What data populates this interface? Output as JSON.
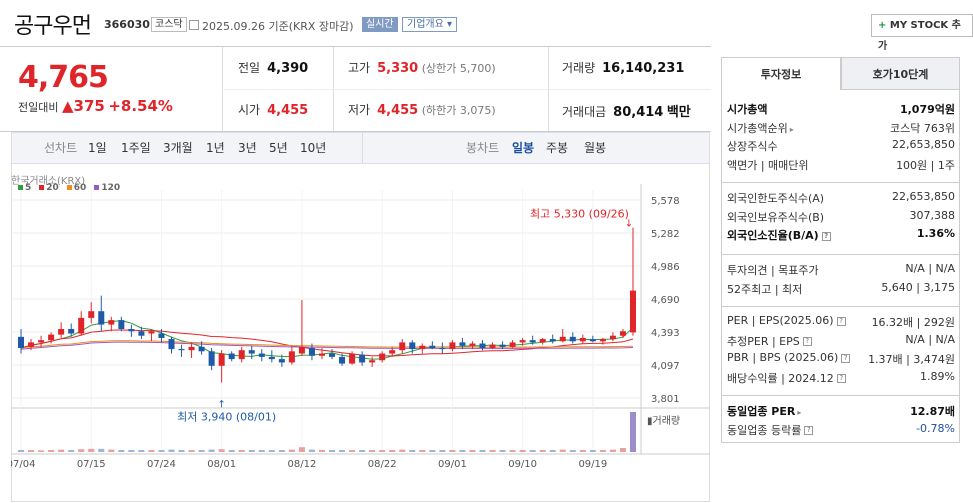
{
  "header": {
    "name": "공구우먼",
    "code": "366030",
    "market": "코스닥",
    "date_info": "2025.09.26 기준(KRX 장마감)",
    "realtime": "실시간",
    "overview": "기업개요",
    "mystock": "MY STOCK 추가",
    "mystock_plus": "+"
  },
  "quote": {
    "price": "4,765",
    "prev_label": "전일대비",
    "change": "▲375",
    "change_pct": "+8.54%",
    "prev_close_label": "전일",
    "prev_close": "4,390",
    "open_label": "시가",
    "open": "4,455",
    "high_label": "고가",
    "high": "5,330",
    "upper_limit": "(상한가 5,700)",
    "low_label": "저가",
    "low": "4,455",
    "lower_limit": "(하한가 3,075)",
    "volume_label": "거래량",
    "volume": "16,140,231",
    "value_label": "거래대금",
    "value": "80,414",
    "value_unit": "백만"
  },
  "periods": {
    "label": "선차트",
    "items": [
      "1일",
      "1주일",
      "3개월",
      "1년",
      "3년",
      "5년",
      "10년"
    ]
  },
  "candle_periods": {
    "label": "봉차트",
    "items": [
      "일봉",
      "주봉",
      "월봉"
    ],
    "active": "일봉"
  },
  "chart_data": {
    "type": "candlestick",
    "source": "한국거래소(KRX)",
    "legend": [
      {
        "name": "5",
        "color": "#2e9e3e"
      },
      {
        "name": "20",
        "color": "#e0252a"
      },
      {
        "name": "60",
        "color": "#f08c1e"
      },
      {
        "name": "120",
        "color": "#9b59c6"
      }
    ],
    "y_ticks": [
      5578,
      5282,
      4986,
      4690,
      4393,
      4097,
      3801
    ],
    "ylim": [
      3801,
      5578
    ],
    "x_ticks": [
      "07/04",
      "07/15",
      "07/24",
      "08/01",
      "08/12",
      "08/22",
      "09/01",
      "09/10",
      "09/19"
    ],
    "x_tick_index": [
      0,
      7,
      14,
      20,
      28,
      36,
      43,
      50,
      57
    ],
    "max_label": "최고 5,330 (09/26)",
    "min_label": "최저 3,940 (08/01)",
    "volume_label": "거래량",
    "candles": [
      [
        4350,
        4420,
        4200,
        4250
      ],
      [
        4260,
        4330,
        4230,
        4300
      ],
      [
        4300,
        4360,
        4260,
        4320
      ],
      [
        4320,
        4390,
        4290,
        4370
      ],
      [
        4370,
        4480,
        4340,
        4420
      ],
      [
        4420,
        4470,
        4350,
        4380
      ],
      [
        4380,
        4580,
        4360,
        4520
      ],
      [
        4520,
        4660,
        4470,
        4580
      ],
      [
        4580,
        4720,
        4400,
        4460
      ],
      [
        4460,
        4530,
        4400,
        4500
      ],
      [
        4500,
        4530,
        4400,
        4420
      ],
      [
        4420,
        4460,
        4350,
        4400
      ],
      [
        4400,
        4440,
        4330,
        4360
      ],
      [
        4380,
        4420,
        4310,
        4400
      ],
      [
        4380,
        4420,
        4300,
        4340
      ],
      [
        4330,
        4350,
        4200,
        4240
      ],
      [
        4240,
        4280,
        4170,
        4230
      ],
      [
        4230,
        4300,
        4160,
        4260
      ],
      [
        4260,
        4310,
        4190,
        4220
      ],
      [
        4220,
        4250,
        4050,
        4090
      ],
      [
        4090,
        4230,
        3940,
        4200
      ],
      [
        4200,
        4220,
        4130,
        4150
      ],
      [
        4150,
        4260,
        4120,
        4230
      ],
      [
        4230,
        4270,
        4150,
        4200
      ],
      [
        4200,
        4240,
        4130,
        4170
      ],
      [
        4170,
        4230,
        4120,
        4150
      ],
      [
        4150,
        4190,
        4080,
        4120
      ],
      [
        4120,
        4260,
        4100,
        4220
      ],
      [
        4200,
        4680,
        4180,
        4260
      ],
      [
        4250,
        4290,
        4140,
        4180
      ],
      [
        4180,
        4250,
        4150,
        4200
      ],
      [
        4200,
        4240,
        4150,
        4170
      ],
      [
        4170,
        4200,
        4090,
        4110
      ],
      [
        4110,
        4220,
        4100,
        4200
      ],
      [
        4190,
        4220,
        4090,
        4120
      ],
      [
        4120,
        4170,
        4080,
        4140
      ],
      [
        4140,
        4220,
        4120,
        4200
      ],
      [
        4200,
        4260,
        4170,
        4230
      ],
      [
        4230,
        4330,
        4200,
        4300
      ],
      [
        4300,
        4320,
        4200,
        4240
      ],
      [
        4240,
        4290,
        4200,
        4270
      ],
      [
        4270,
        4310,
        4240,
        4250
      ],
      [
        4250,
        4300,
        4200,
        4240
      ],
      [
        4240,
        4320,
        4220,
        4300
      ],
      [
        4300,
        4340,
        4240,
        4270
      ],
      [
        4270,
        4310,
        4240,
        4290
      ],
      [
        4290,
        4320,
        4230,
        4250
      ],
      [
        4250,
        4300,
        4240,
        4280
      ],
      [
        4280,
        4310,
        4240,
        4260
      ],
      [
        4260,
        4320,
        4250,
        4300
      ],
      [
        4300,
        4340,
        4270,
        4320
      ],
      [
        4320,
        4360,
        4280,
        4300
      ],
      [
        4300,
        4340,
        4280,
        4330
      ],
      [
        4330,
        4370,
        4290,
        4310
      ],
      [
        4310,
        4420,
        4300,
        4350
      ],
      [
        4350,
        4390,
        4290,
        4310
      ],
      [
        4310,
        4370,
        4290,
        4340
      ],
      [
        4330,
        4360,
        4300,
        4310
      ],
      [
        4310,
        4340,
        4280,
        4330
      ],
      [
        4330,
        4390,
        4310,
        4360
      ],
      [
        4360,
        4420,
        4340,
        4400
      ],
      [
        4390,
        5330,
        4360,
        4765
      ]
    ],
    "volume": [
      5,
      5,
      4,
      5,
      6,
      5,
      7,
      8,
      8,
      6,
      5,
      5,
      5,
      5,
      5,
      6,
      5,
      5,
      5,
      6,
      7,
      5,
      5,
      5,
      5,
      5,
      5,
      6,
      12,
      6,
      5,
      5,
      5,
      5,
      5,
      5,
      5,
      5,
      6,
      5,
      5,
      5,
      5,
      5,
      5,
      5,
      5,
      5,
      5,
      5,
      5,
      5,
      5,
      5,
      6,
      5,
      5,
      5,
      5,
      6,
      10,
      100
    ]
  },
  "info": {
    "tab1": "투자정보",
    "tab2": "호가10단계",
    "s1": [
      {
        "k": "시가총액",
        "v": "1,079억원",
        "bold": true
      },
      {
        "k": "시가총액순위",
        "v": "코스닥 763위",
        "arrow": true
      },
      {
        "k": "상장주식수",
        "v": "22,653,850"
      },
      {
        "k": "액면가 | 매매단위",
        "v": "100원 | 1주"
      }
    ],
    "s2": [
      {
        "k": "외국인한도주식수(A)",
        "v": "22,653,850"
      },
      {
        "k": "외국인보유주식수(B)",
        "v": "307,388"
      },
      {
        "k": "외국인소진율(B/A)",
        "v": "1.36%",
        "bold": true,
        "q": true
      }
    ],
    "s3": [
      {
        "k": "투자의견 | 목표주가",
        "v": "N/A | N/A"
      },
      {
        "k": "52주최고 | 최저",
        "v": "5,640 | 3,175"
      }
    ],
    "s4": [
      {
        "k": "PER | EPS(2025.06)",
        "v": "16.32배 | 292원",
        "q": true
      },
      {
        "k": "추정PER | EPS",
        "v": "N/A | N/A",
        "q": true
      },
      {
        "k": "PBR | BPS (2025.06)",
        "v": "1.37배 | 3,474원",
        "q": true
      },
      {
        "k": "배당수익률 | 2024.12",
        "v": "1.89%",
        "q": true
      }
    ],
    "s5": [
      {
        "k": "동일업종 PER",
        "v": "12.87배",
        "bold": true,
        "arrow": true
      },
      {
        "k": "동일업종 등락률",
        "v": "-0.78%",
        "blue": true,
        "q": true
      }
    ]
  }
}
